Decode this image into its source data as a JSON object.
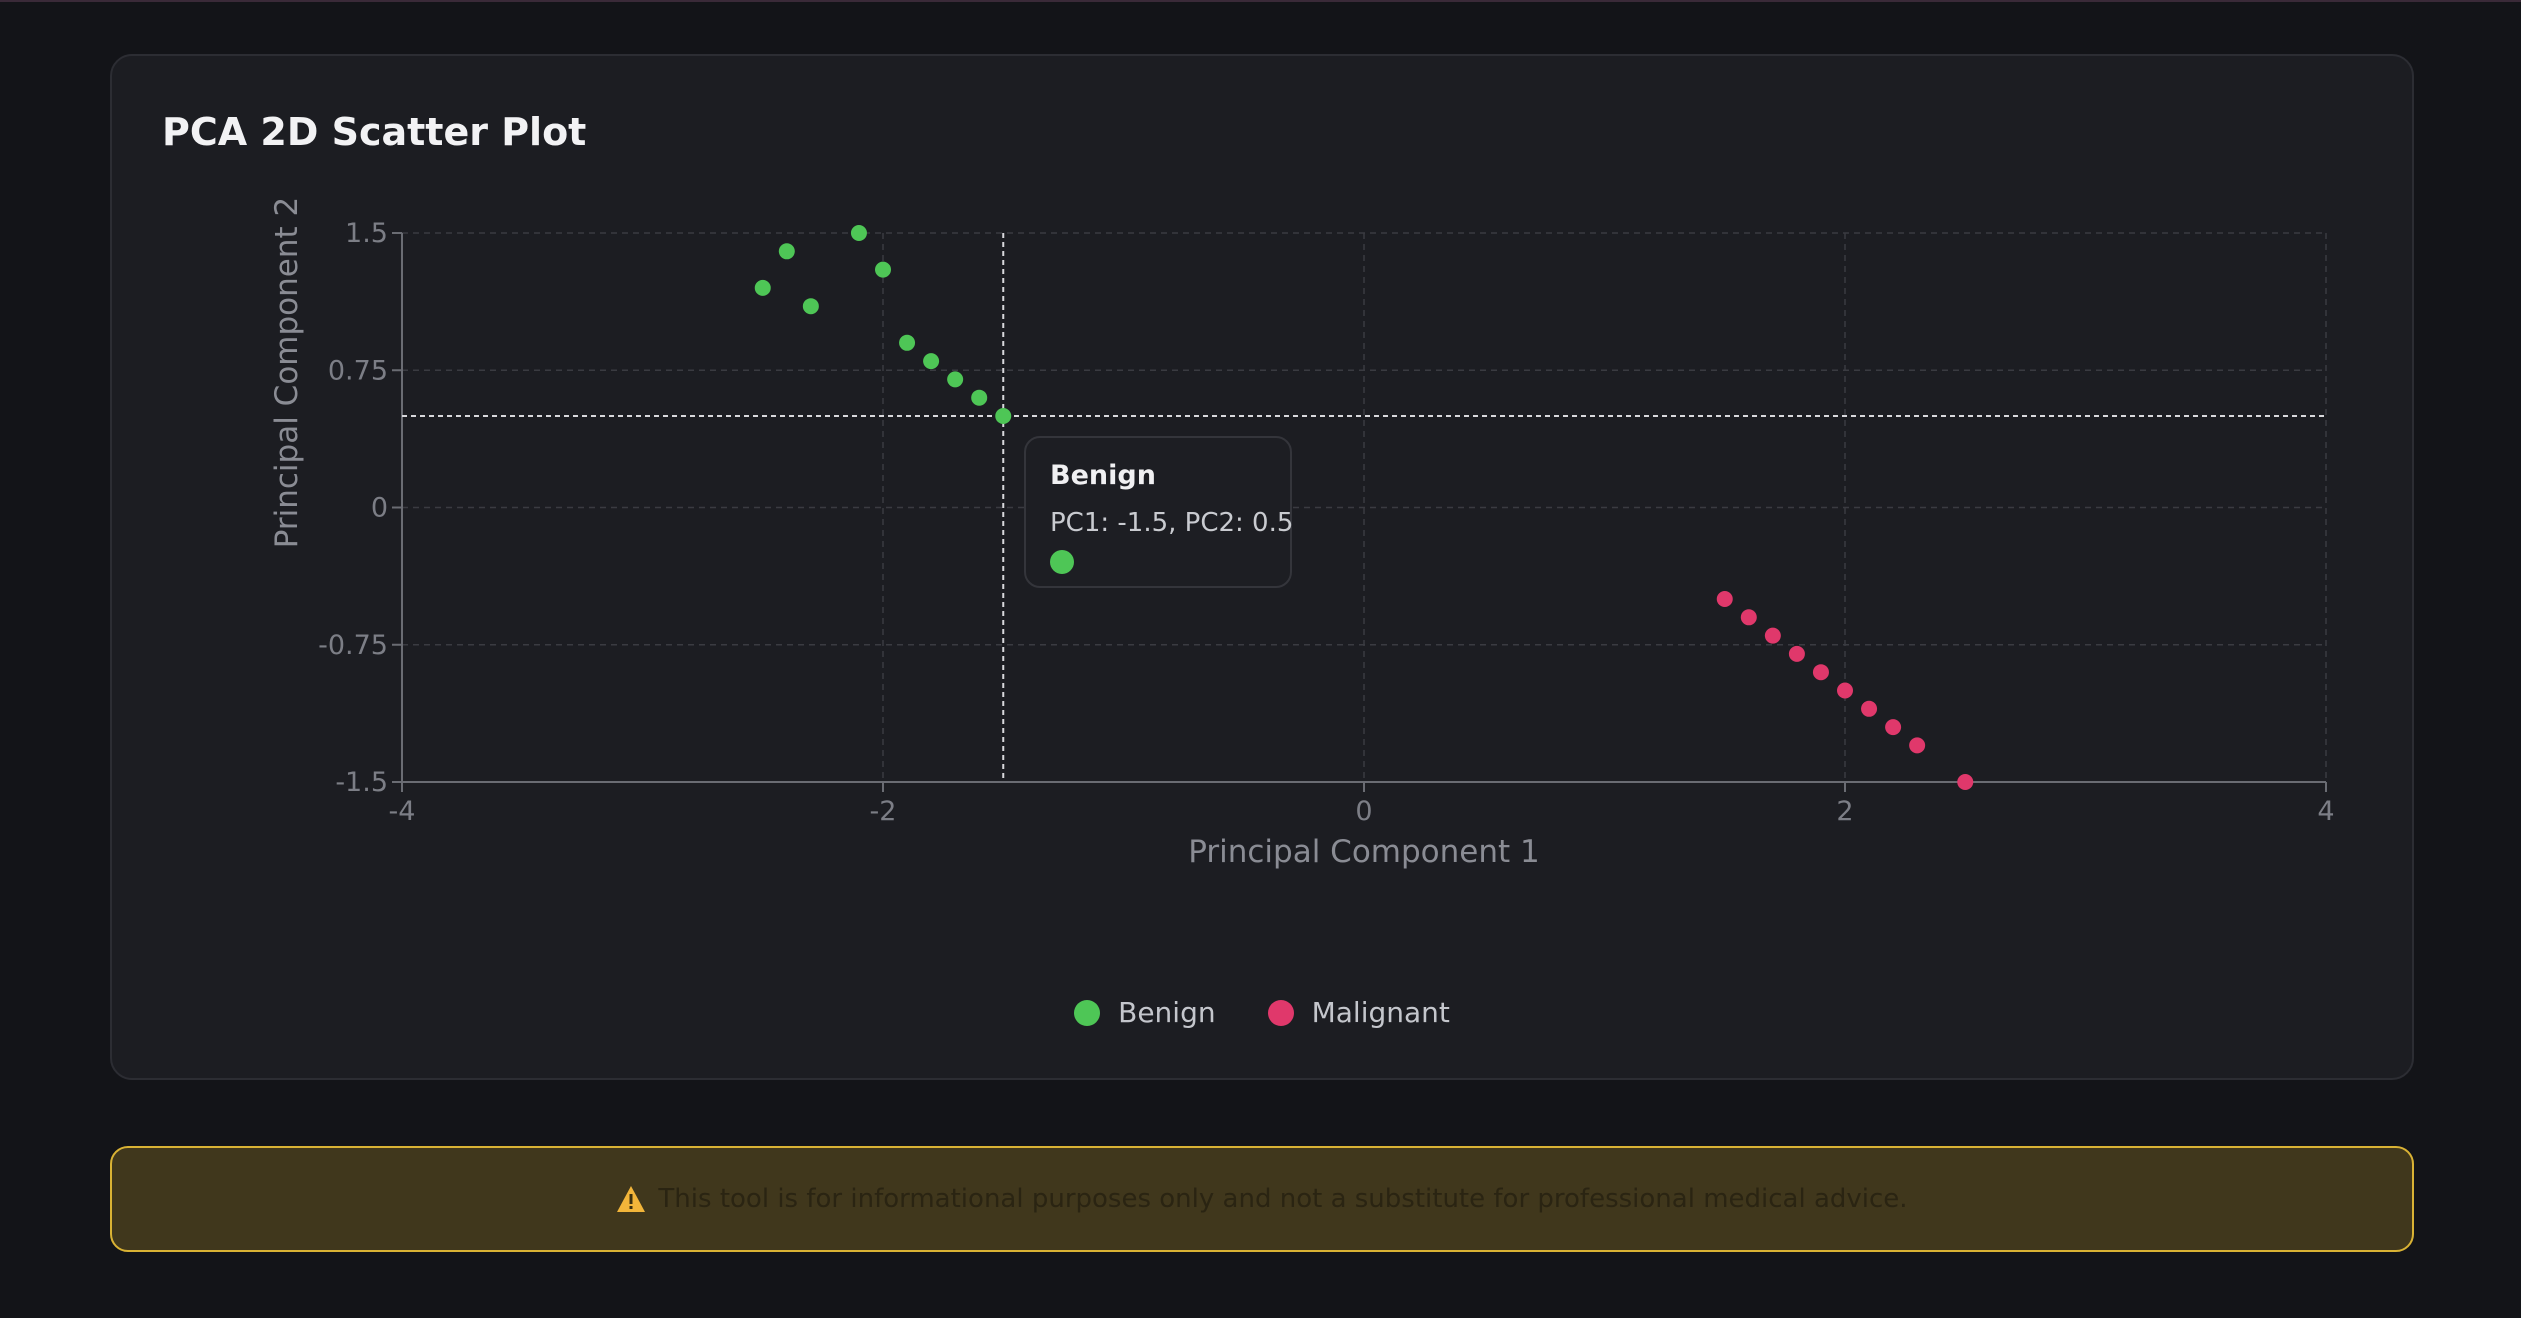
{
  "card": {
    "title": "PCA 2D Scatter Plot"
  },
  "colors": {
    "benign": "#4ec656",
    "malignant": "#e0386b",
    "warning_icon": "#f2b53a"
  },
  "chart_data": {
    "type": "scatter",
    "title": "PCA 2D Scatter Plot",
    "xlabel": "Principal Component 1",
    "ylabel": "Principal Component 2",
    "xlim": [
      -4,
      4
    ],
    "ylim": [
      -1.5,
      1.5
    ],
    "x_ticks": [
      -4,
      -2,
      0,
      2,
      4
    ],
    "y_ticks": [
      -1.5,
      -0.75,
      0,
      0.75,
      1.5
    ],
    "x_tick_labels": [
      "-4",
      "-2",
      "0",
      "2",
      "4"
    ],
    "y_tick_labels": [
      "-1.5",
      "-0.75",
      "0",
      "0.75",
      "1.5"
    ],
    "grid": true,
    "legend_position": "bottom-center",
    "series": [
      {
        "name": "Benign",
        "color": "#4ec656",
        "points": [
          [
            -2.5,
            1.2
          ],
          [
            -2.4,
            1.4
          ],
          [
            -2.3,
            1.1
          ],
          [
            -2.1,
            1.5
          ],
          [
            -2.0,
            1.3
          ],
          [
            -1.9,
            0.9
          ],
          [
            -1.8,
            0.8
          ],
          [
            -1.7,
            0.7
          ],
          [
            -1.6,
            0.6
          ],
          [
            -1.5,
            0.5
          ]
        ]
      },
      {
        "name": "Malignant",
        "color": "#e0386b",
        "points": [
          [
            1.5,
            -0.5
          ],
          [
            1.6,
            -0.6
          ],
          [
            1.7,
            -0.7
          ],
          [
            1.8,
            -0.8
          ],
          [
            1.9,
            -0.9
          ],
          [
            2.0,
            -1.0
          ],
          [
            2.1,
            -1.1
          ],
          [
            2.2,
            -1.2
          ],
          [
            2.3,
            -1.3
          ],
          [
            2.5,
            -1.5
          ]
        ]
      }
    ],
    "tooltip": {
      "series": "Benign",
      "x": -1.5,
      "y": 0.5,
      "text": "PC1: -1.5, PC2: 0.5"
    }
  },
  "disclaimer": {
    "icon": "warning-icon",
    "text": "This tool is for informational purposes only and not a substitute for professional medical advice."
  }
}
